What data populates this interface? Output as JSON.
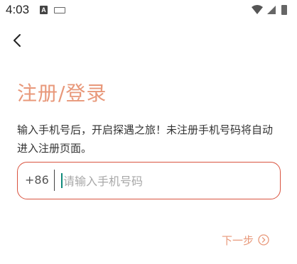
{
  "status_bar": {
    "time": "4:03",
    "icons": [
      "app-notification-icon",
      "keyboard-icon",
      "wifi-icon",
      "signal-icon",
      "battery-icon"
    ]
  },
  "header": {
    "back_icon": "back-arrow-icon"
  },
  "page": {
    "title": "注册/登录",
    "description": "输入手机号后，开启探遇之旅！未注册手机号码将自动进入注册页面。"
  },
  "phone_field": {
    "country_code": "+86",
    "value": "",
    "placeholder": "请输入手机号码"
  },
  "next": {
    "label": "下一步",
    "icon": "chevron-circle-right-icon"
  },
  "colors": {
    "accent": "#e8987a",
    "field_border": "#d9533f",
    "caret": "#0e8a7a"
  }
}
